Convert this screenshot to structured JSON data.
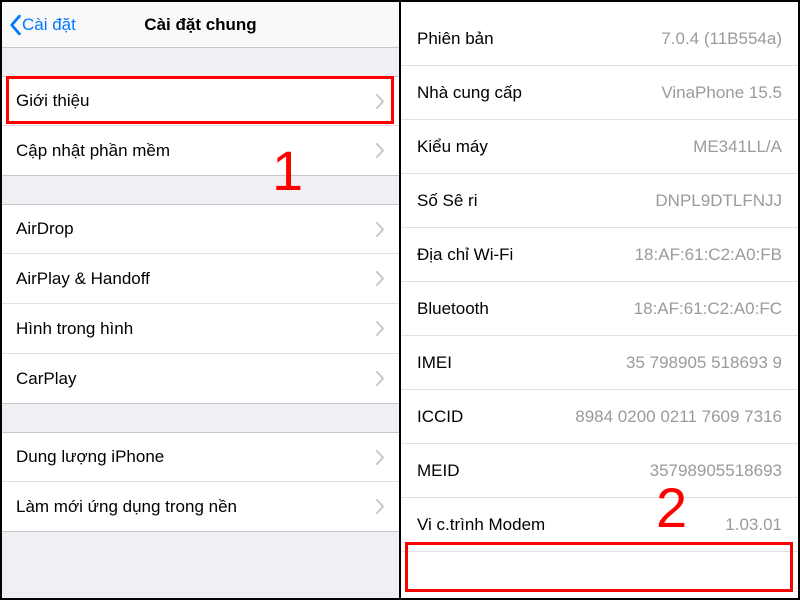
{
  "left": {
    "back_label": "Cài đặt",
    "title": "Cài đặt chung",
    "section1": [
      {
        "label": "Giới thiệu"
      },
      {
        "label": "Cập nhật phần mềm"
      }
    ],
    "section2": [
      {
        "label": "AirDrop"
      },
      {
        "label": "AirPlay & Handoff"
      },
      {
        "label": "Hình trong hình"
      },
      {
        "label": "CarPlay"
      }
    ],
    "section3": [
      {
        "label": "Dung lượng iPhone"
      },
      {
        "label": "Làm mới ứng dụng trong nền"
      }
    ]
  },
  "right": {
    "rows": [
      {
        "label": "Phiên bản",
        "value": "7.0.4 (11B554a)"
      },
      {
        "label": "Nhà cung cấp",
        "value": "VinaPhone 15.5"
      },
      {
        "label": "Kiểu máy",
        "value": "ME341LL/A"
      },
      {
        "label": "Số Sê ri",
        "value": "DNPL9DTLFNJJ"
      },
      {
        "label": "Địa chỉ Wi-Fi",
        "value": "18:AF:61:C2:A0:FB"
      },
      {
        "label": "Bluetooth",
        "value": "18:AF:61:C2:A0:FC"
      },
      {
        "label": "IMEI",
        "value": "35 798905 518693 9"
      },
      {
        "label": "ICCID",
        "value": "8984 0200 0211 7609 7316"
      },
      {
        "label": "MEID",
        "value": "35798905518693"
      },
      {
        "label": "Vi c.trình Modem",
        "value": "1.03.01"
      }
    ]
  },
  "annotations": {
    "one": "1",
    "two": "2"
  }
}
